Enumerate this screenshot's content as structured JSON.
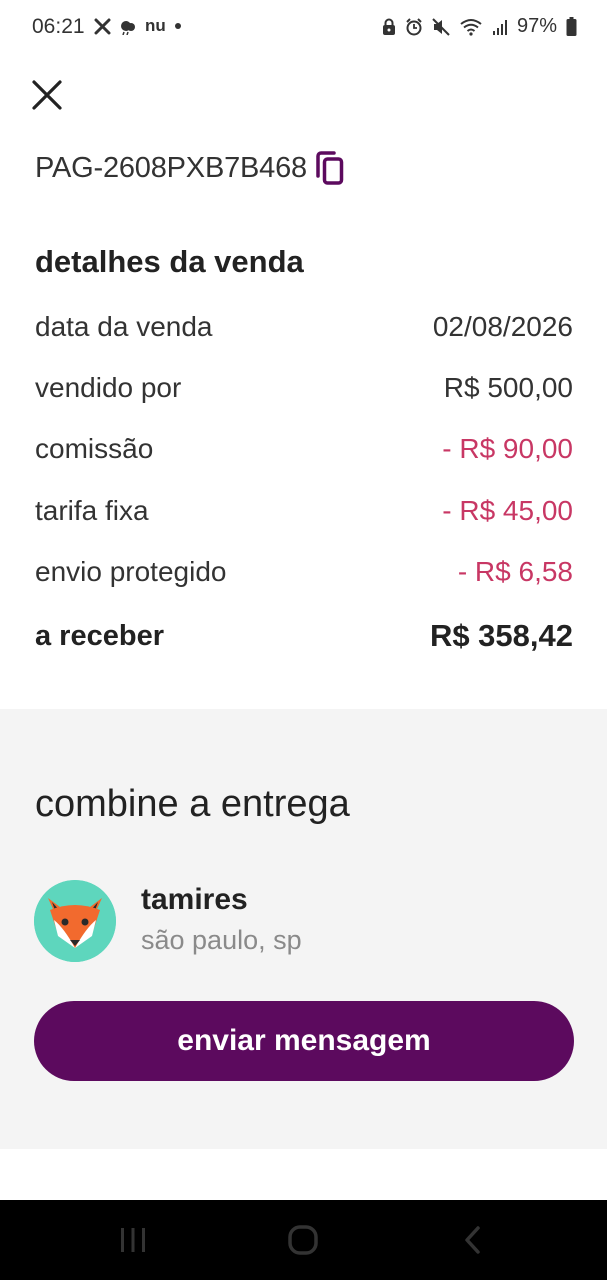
{
  "status_bar": {
    "time": "06:21",
    "left_icons": [
      "x-app-icon",
      "weather-icon",
      "nu-icon",
      "dot-icon"
    ],
    "nu_label": "nu",
    "battery_percent": "97%",
    "right_icons": [
      "lock-icon",
      "alarm-icon",
      "mute-icon",
      "wifi-icon",
      "signal-icon",
      "battery-icon"
    ]
  },
  "header": {
    "close_icon": "close-icon",
    "order_id": "PAG-2608PXB7B468",
    "copy_icon": "copy-icon"
  },
  "details": {
    "title": "detalhes da venda",
    "rows": [
      {
        "label": "data da venda",
        "value": "02/08/2026"
      },
      {
        "label": "vendido por",
        "value": "R$ 500,00"
      },
      {
        "label": "comissão",
        "value": "- R$ 90,00"
      },
      {
        "label": "tarifa fixa",
        "value": "- R$ 45,00"
      },
      {
        "label": "envio protegido",
        "value": "- R$ 6,58"
      }
    ],
    "total_label": "a receber",
    "total_value": "R$ 358,42"
  },
  "delivery": {
    "title": "combine a entrega",
    "seller_name": "tamires",
    "seller_location": "são paulo, sp",
    "avatar_icon": "fox-avatar",
    "message_button": "enviar mensagem"
  },
  "nav": {
    "recents_icon": "recents-icon",
    "home_icon": "home-icon",
    "back_icon": "back-icon"
  },
  "colors": {
    "accent": "#5c0a5e",
    "negative": "#c83764",
    "section_bg": "#f4f4f4",
    "avatar_bg": "#5ed6bd"
  }
}
